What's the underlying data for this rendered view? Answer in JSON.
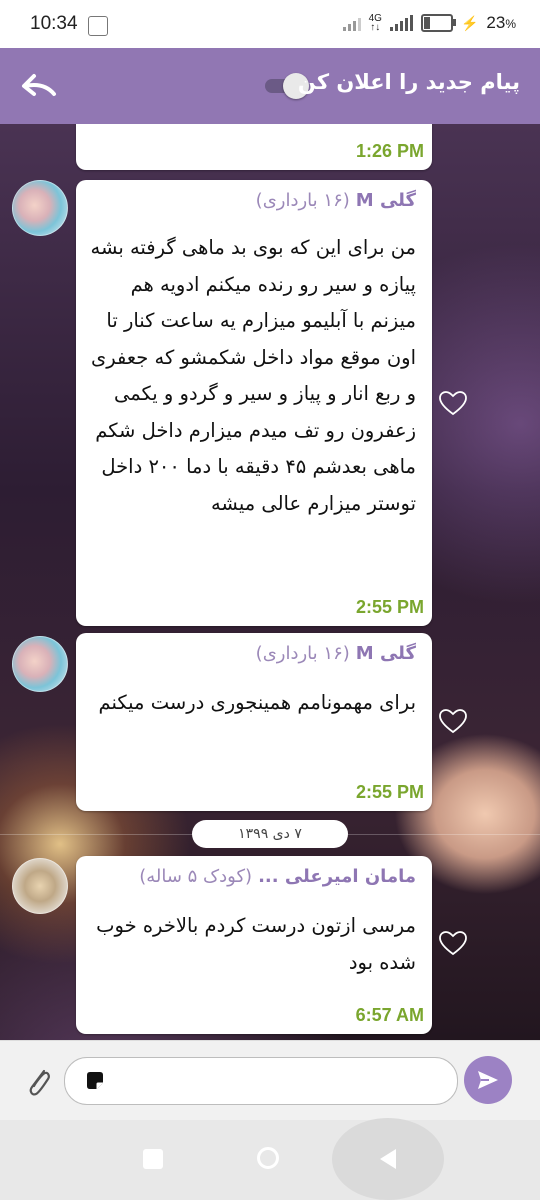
{
  "status_bar": {
    "time": "10:34",
    "network": "4G",
    "battery": "23",
    "battery_unit": "%",
    "battery_level": 0.23
  },
  "header": {
    "title": "پیام جدید را اعلان کن",
    "notify_toggle_on": true,
    "colors": {
      "header": "#9177b3"
    }
  },
  "messages": [
    {
      "time": "1:26 PM",
      "partial": true
    },
    {
      "sender": "گلی M",
      "tag": "(۱۶ بارداری)",
      "text": "من برای این که بوی بد ماهی گرفته بشه پیازه و سیر رو رنده میکنم ادویه هم میزنم با آبلیمو میزارم یه ساعت کنار تا اون موقع مواد داخل شکمشو که جعفری و ربع انار و پیاز و سیر و گردو و یکمی زعفرون رو تف میدم میزارم داخل شکم ماهی بعدشم ۴۵ دقیقه با دما ۲۰۰ داخل توستر میزارم عالی میشه",
      "time": "2:55 PM"
    },
    {
      "sender": "گلی M",
      "tag": "(۱۶ بارداری)",
      "text": "برای مهمونامم همینجوری درست میکنم",
      "time": "2:55 PM"
    },
    {
      "sender": "مامان امیرعلی ...",
      "tag": "(کودک ۵ ساله)",
      "text": "مرسی ازتون درست کردم بالاخره خوب شده بود",
      "time": "6:57 AM"
    }
  ],
  "date_separator": "۷ دی ۱۳۹۹",
  "composer": {
    "placeholder": ""
  },
  "colors": {
    "accent": "#9c82c4",
    "sender": "#8e76b3",
    "time": "#7aa62e"
  }
}
